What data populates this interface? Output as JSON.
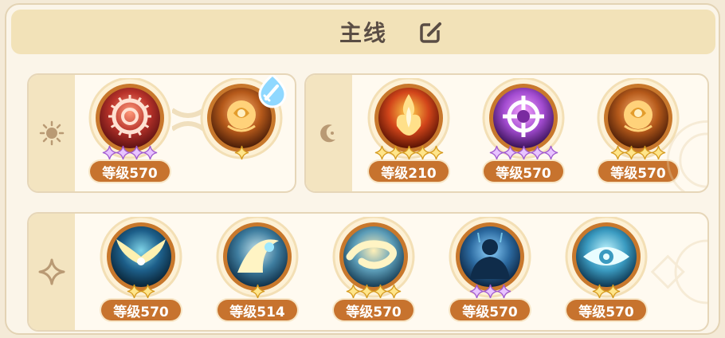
{
  "header": {
    "title": "主线",
    "edit_icon": "edit-icon"
  },
  "colors": {
    "level_badge": "#c7732e",
    "star_gold": "#f2c94c",
    "star_purple": "#c78be8",
    "tab_bg": "#f3e4c0"
  },
  "groups": [
    {
      "icon": "sun-icon",
      "skills": [
        {
          "name": "thorn-ring-skill",
          "level": "等级570",
          "stars": 4,
          "star_color": "purple",
          "theme": "red",
          "has_badge": false
        },
        {
          "name": "golden-rose-skill",
          "level": "",
          "stars": 1,
          "star_color": "gold",
          "theme": "rose",
          "has_badge": true,
          "badge_icon": "sword-droplet-icon"
        }
      ]
    },
    {
      "icon": "moon-icon",
      "skills": [
        {
          "name": "flame-spirit-skill",
          "level": "等级210",
          "stars": 5,
          "star_color": "gold",
          "theme": "fire"
        },
        {
          "name": "crosshair-skill",
          "level": "等级570",
          "stars": 5,
          "star_color": "purple",
          "theme": "purple"
        },
        {
          "name": "rose-bloom-skill",
          "level": "等级570",
          "stars": 4,
          "star_color": "gold",
          "theme": "rose"
        }
      ]
    },
    {
      "icon": "sparkle-icon",
      "skills": [
        {
          "name": "golden-wings-skill",
          "level": "等级570",
          "stars": 2,
          "star_color": "gold",
          "theme": "wings"
        },
        {
          "name": "spirit-leap-skill",
          "level": "等级514",
          "stars": 1,
          "star_color": "gold",
          "theme": "spirit"
        },
        {
          "name": "vortex-skill",
          "level": "等级570",
          "stars": 4,
          "star_color": "gold",
          "theme": "vortex"
        },
        {
          "name": "silhouette-skill",
          "level": "等级570",
          "stars": 3,
          "star_color": "purple",
          "theme": "silhouette"
        },
        {
          "name": "all-seeing-eye-skill",
          "level": "等级570",
          "stars": 2,
          "star_color": "gold",
          "theme": "eye"
        }
      ]
    }
  ]
}
